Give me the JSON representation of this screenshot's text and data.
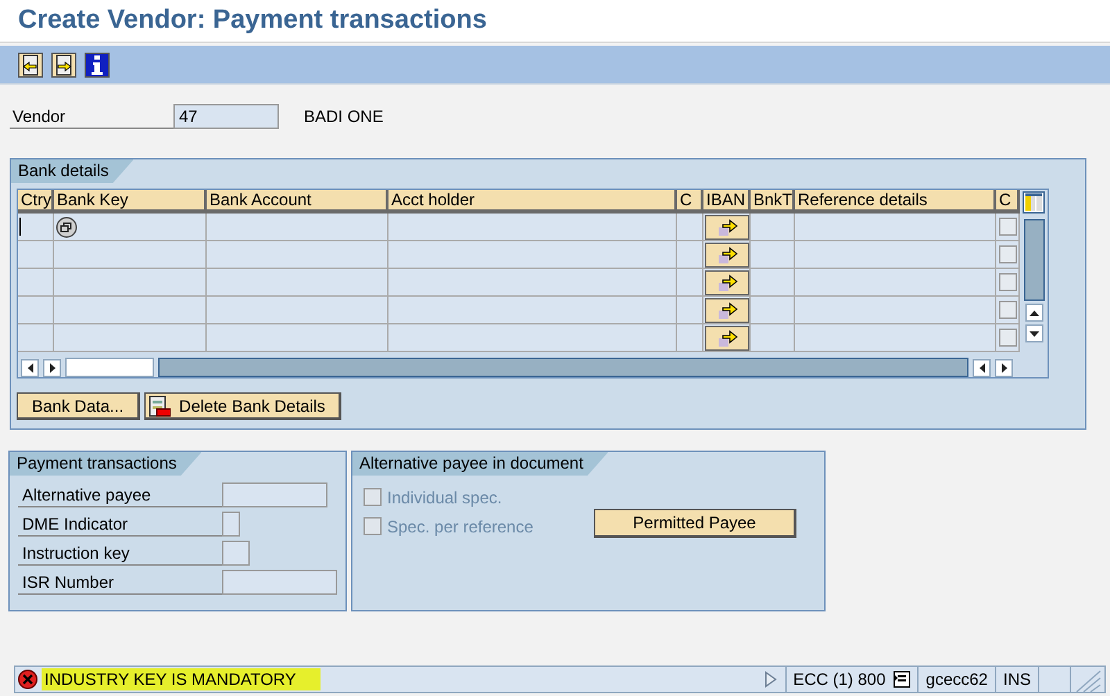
{
  "window": {
    "title": "Create Vendor: Payment transactions"
  },
  "toolbar": {
    "buttons": [
      {
        "kind": "previous"
      },
      {
        "kind": "next"
      },
      {
        "kind": "info"
      }
    ]
  },
  "vendor": {
    "label": "Vendor",
    "value": "47",
    "name": "BADI ONE"
  },
  "bank_details": {
    "title": "Bank details",
    "columns": [
      "Ctry",
      "Bank Key",
      "Bank Account",
      "Acct holder",
      "C",
      "IBAN",
      "BnkT",
      "Reference details",
      "C"
    ],
    "rows": [
      {
        "checked": false
      },
      {
        "checked": false
      },
      {
        "checked": false
      },
      {
        "checked": false
      },
      {
        "checked": false
      }
    ],
    "buttons": [
      {
        "label": "Bank Data...",
        "kind": "plain"
      },
      {
        "label": "Delete Bank Details",
        "kind": "delete"
      }
    ]
  },
  "payment_transactions": {
    "title": "Payment transactions",
    "fields": [
      {
        "label": "Alternative payee"
      },
      {
        "label": "DME Indicator"
      },
      {
        "label": "Instruction key"
      },
      {
        "label": "ISR Number"
      }
    ]
  },
  "alternative_payee": {
    "title": "Alternative payee in document",
    "options": [
      {
        "label": "Individual spec.",
        "checked": false,
        "disabled": true
      },
      {
        "label": "Spec. per reference",
        "checked": false,
        "disabled": true
      }
    ],
    "button": "Permitted Payee"
  },
  "status_bar": {
    "message": "INDUSTRY KEY IS MANDATORY",
    "highlighted": true,
    "system": "ECC (1) 800",
    "server": "gcecc62",
    "mode": "INS"
  }
}
